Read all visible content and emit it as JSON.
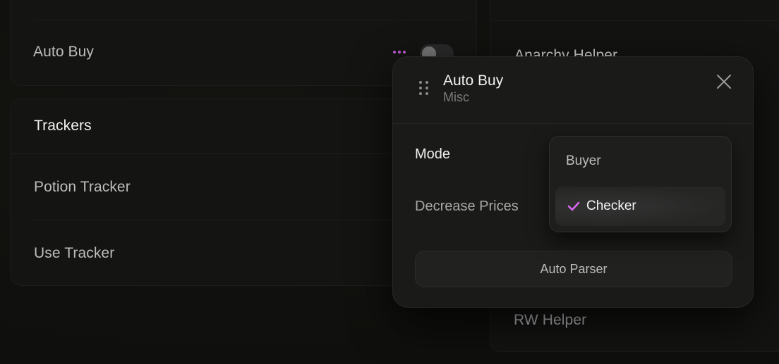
{
  "left_panel": {
    "top_card": {
      "auto_buy_label": "Auto Buy"
    },
    "trackers_card": {
      "header": "Trackers",
      "items": [
        {
          "label": "Potion Tracker"
        },
        {
          "label": "Use Tracker"
        }
      ]
    }
  },
  "right_panel": {
    "items": [
      {
        "label": "Anarchy Helper"
      },
      {
        "label": "RW Helper"
      }
    ]
  },
  "popup": {
    "title": "Auto Buy",
    "subtitle": "Misc",
    "settings": {
      "mode_label": "Mode",
      "decrease_prices_label": "Decrease Prices"
    },
    "action_button_label": "Auto Parser"
  },
  "dropdown": {
    "options": [
      {
        "label": "Buyer",
        "selected": false
      },
      {
        "label": "Checker",
        "selected": true
      }
    ]
  },
  "colors": {
    "accent": "#c45ad6",
    "check": "#d867f0",
    "background": "#0f0f0d",
    "card": "#141413",
    "popup": "#1a1a19"
  },
  "icons": {
    "menu": "more-dots-icon",
    "drag": "drag-handle-icon",
    "close": "close-icon",
    "selected": "checkmark-icon"
  }
}
